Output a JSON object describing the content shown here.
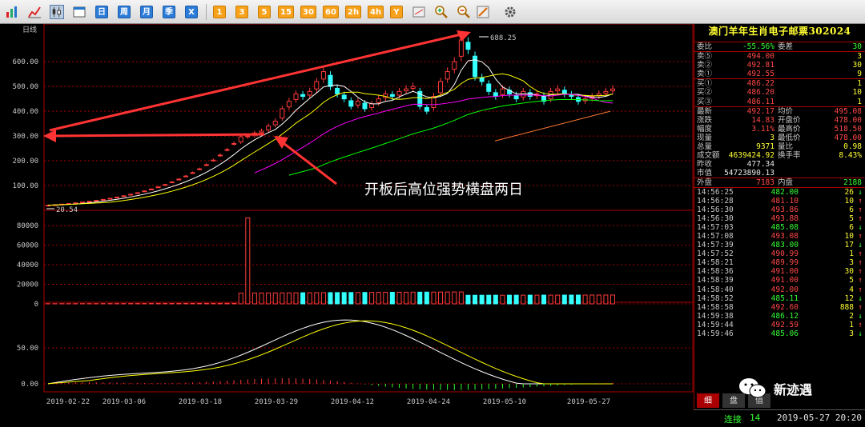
{
  "toolbar": {
    "period_buttons": [
      "日",
      "周",
      "月",
      "季",
      "X"
    ],
    "minute_buttons": [
      "1",
      "3",
      "5",
      "15",
      "30",
      "60",
      "2h",
      "4h",
      "Y"
    ],
    "icons": [
      "bar-chart-icon",
      "line-chart-icon",
      "candlestick-icon",
      "window-icon",
      "zoom-in-icon",
      "zoom-out-icon",
      "pen-icon",
      "gear-icon"
    ]
  },
  "chart": {
    "period_label": "日线",
    "price_axis": [
      "600.00",
      "500.00",
      "400.00",
      "300.00",
      "200.00",
      "100.00"
    ],
    "volume_axis": [
      "80000",
      "60000",
      "40000",
      "20000",
      "0"
    ],
    "macd_axis": [
      "50.00",
      "0.00"
    ],
    "dates": [
      "2019-02-22",
      "2019-03-06",
      "2019-03-18",
      "2019-03-29",
      "2019-04-12",
      "2019-04-24",
      "2019-05-10",
      "2019-05-27"
    ],
    "high_label": "688.25",
    "low_label": "20.54",
    "annotation": "开板后高位强势横盘两日",
    "colors": {
      "up": "#ff3b3b",
      "down": "#33ffff",
      "ma5": "#ffffff",
      "ma10": "#ffff00",
      "ma20": "#ff00ff",
      "ma60": "#00ff00",
      "grid": "#aa0000"
    }
  },
  "chart_data": {
    "type": "candlestick",
    "ylim": [
      0,
      720
    ],
    "closes": [
      20.5,
      22.6,
      24.9,
      27.4,
      30.1,
      33.1,
      36.4,
      40.1,
      44.1,
      48.5,
      53.4,
      58.7,
      64.6,
      71.0,
      78.1,
      85.9,
      94.5,
      104.0,
      114.4,
      125.8,
      138.4,
      152.2,
      167.4,
      184.2,
      202.6,
      222.9,
      245.2,
      269.7,
      296.7,
      300,
      312,
      320,
      340,
      360,
      410,
      440,
      470,
      460,
      480,
      520,
      560,
      500,
      470,
      450,
      420,
      440,
      410,
      430,
      450,
      470,
      460,
      480,
      490,
      500,
      420,
      400,
      460,
      520,
      560,
      600,
      688,
      650,
      540,
      520,
      480,
      460,
      490,
      470,
      450,
      480,
      460,
      470,
      440,
      480,
      490,
      470,
      460,
      440,
      450,
      460,
      470,
      480,
      490
    ]
  },
  "panel": {
    "title": "澳门羊年生肖电子邮票302024",
    "weibi": {
      "label": "委比",
      "value": "-55.56%",
      "label2": "委差",
      "value2": "30"
    },
    "asks": [
      {
        "label": "卖⑤",
        "price": "494.00",
        "vol": "3"
      },
      {
        "label": "卖②",
        "price": "492.81",
        "vol": "30"
      },
      {
        "label": "卖①",
        "price": "492.55",
        "vol": "9"
      }
    ],
    "bids": [
      {
        "label": "买①",
        "price": "486.22",
        "vol": "1"
      },
      {
        "label": "买②",
        "price": "486.20",
        "vol": "10"
      },
      {
        "label": "买③",
        "price": "486.11",
        "vol": "1"
      }
    ],
    "quote": [
      {
        "l1": "最新",
        "v1": "492.17",
        "l2": "均价",
        "v2": "495.08"
      },
      {
        "l1": "涨跌",
        "v1": "14.83",
        "l2": "开盘价",
        "v2": "478.00"
      },
      {
        "l1": "幅度",
        "v1": "3.11%",
        "l2": "最高价",
        "v2": "518.50"
      },
      {
        "l1": "现量",
        "v1": "3",
        "l2": "最低价",
        "v2": "478.00"
      },
      {
        "l1": "总量",
        "v1": "9371",
        "l2": "量比",
        "v2": "0.98"
      },
      {
        "l1": "成交额",
        "v1": "4639424.92",
        "l2": "换手率",
        "v2": "8.43%"
      }
    ],
    "prev_close": {
      "label": "昨收",
      "value": "477.34"
    },
    "market_cap": {
      "label": "市值",
      "value": "54723890.13"
    },
    "outer_inner": {
      "l1": "外盘",
      "v1": "7183",
      "l2": "内盘",
      "v2": "2188"
    },
    "ticks": [
      {
        "time": "14:56:25",
        "price": "482.00",
        "vol": "26",
        "dir": "down"
      },
      {
        "time": "14:56:28",
        "price": "481.10",
        "vol": "10",
        "dir": "up"
      },
      {
        "time": "14:56:30",
        "price": "493.86",
        "vol": "6",
        "dir": "up"
      },
      {
        "time": "14:56:30",
        "price": "493.88",
        "vol": "5",
        "dir": "up"
      },
      {
        "time": "14:57:03",
        "price": "485.08",
        "vol": "6",
        "dir": "down"
      },
      {
        "time": "14:57:08",
        "price": "493.08",
        "vol": "10",
        "dir": "up"
      },
      {
        "time": "14:57:39",
        "price": "483.00",
        "vol": "17",
        "dir": "down"
      },
      {
        "time": "14:57:52",
        "price": "490.99",
        "vol": "1",
        "dir": "up"
      },
      {
        "time": "14:58:21",
        "price": "489.99",
        "vol": "3",
        "dir": "up"
      },
      {
        "time": "14:58:36",
        "price": "491.00",
        "vol": "30",
        "dir": "up"
      },
      {
        "time": "14:58:39",
        "price": "491.00",
        "vol": "5",
        "dir": "up"
      },
      {
        "time": "14:58:40",
        "price": "492.00",
        "vol": "4",
        "dir": "up"
      },
      {
        "time": "14:58:52",
        "price": "485.11",
        "vol": "12",
        "dir": "down"
      },
      {
        "time": "14:58:58",
        "price": "492.60",
        "vol": "888",
        "dir": "up"
      },
      {
        "time": "14:59:38",
        "price": "486.12",
        "vol": "2",
        "dir": "down"
      },
      {
        "time": "14:59:44",
        "price": "492.59",
        "vol": "1",
        "dir": "up"
      },
      {
        "time": "14:59:46",
        "price": "485.06",
        "vol": "3",
        "dir": "down"
      }
    ],
    "tabs": [
      "细",
      "盘",
      "值"
    ]
  },
  "status": {
    "label": "连接",
    "count": "14",
    "datetime": "2019-05-27 20:20"
  },
  "watermark": {
    "label": "新迹遇",
    "icon": "wechat-icon"
  }
}
